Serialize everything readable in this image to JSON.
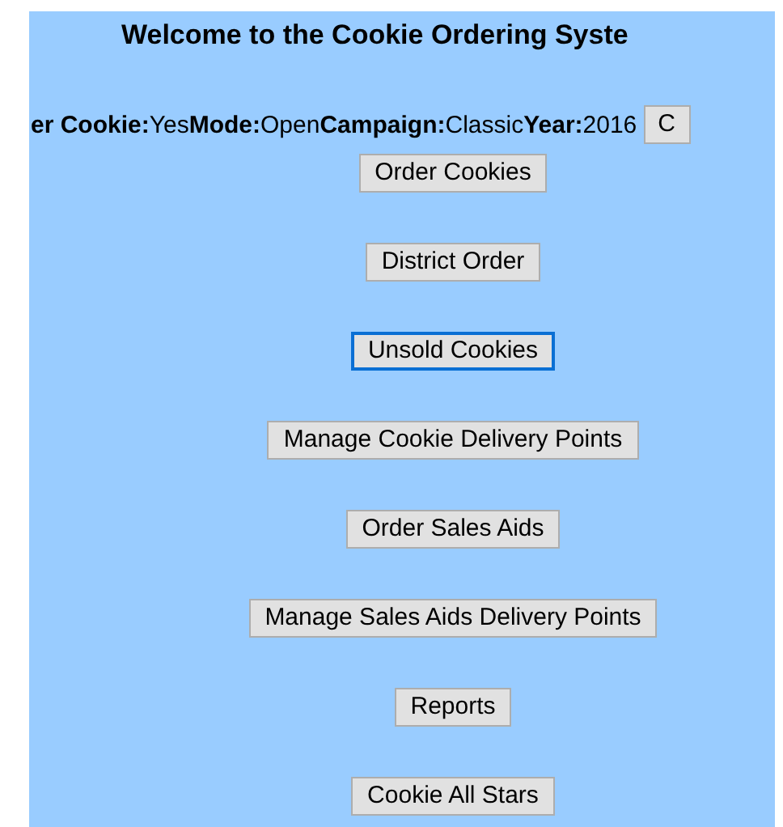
{
  "title": "Welcome to the Cookie Ordering Syste",
  "status_fields": [
    {
      "label": "er Cookie:",
      "value": "Yes"
    },
    {
      "label": "Mode:",
      "value": "Open"
    },
    {
      "label": "Campaign:",
      "value": "Classic"
    },
    {
      "label": "Year:",
      "value": "2016"
    }
  ],
  "status_button": "C",
  "buttons": [
    {
      "label": "Order Cookies",
      "focused": false
    },
    {
      "label": "District Order",
      "focused": false
    },
    {
      "label": "Unsold Cookies",
      "focused": true
    },
    {
      "label": "Manage Cookie Delivery Points",
      "focused": false
    },
    {
      "label": "Order Sales Aids",
      "focused": false
    },
    {
      "label": "Manage Sales Aids Delivery Points",
      "focused": false
    },
    {
      "label": "Reports",
      "focused": false
    },
    {
      "label": "Cookie All Stars",
      "focused": false
    }
  ]
}
